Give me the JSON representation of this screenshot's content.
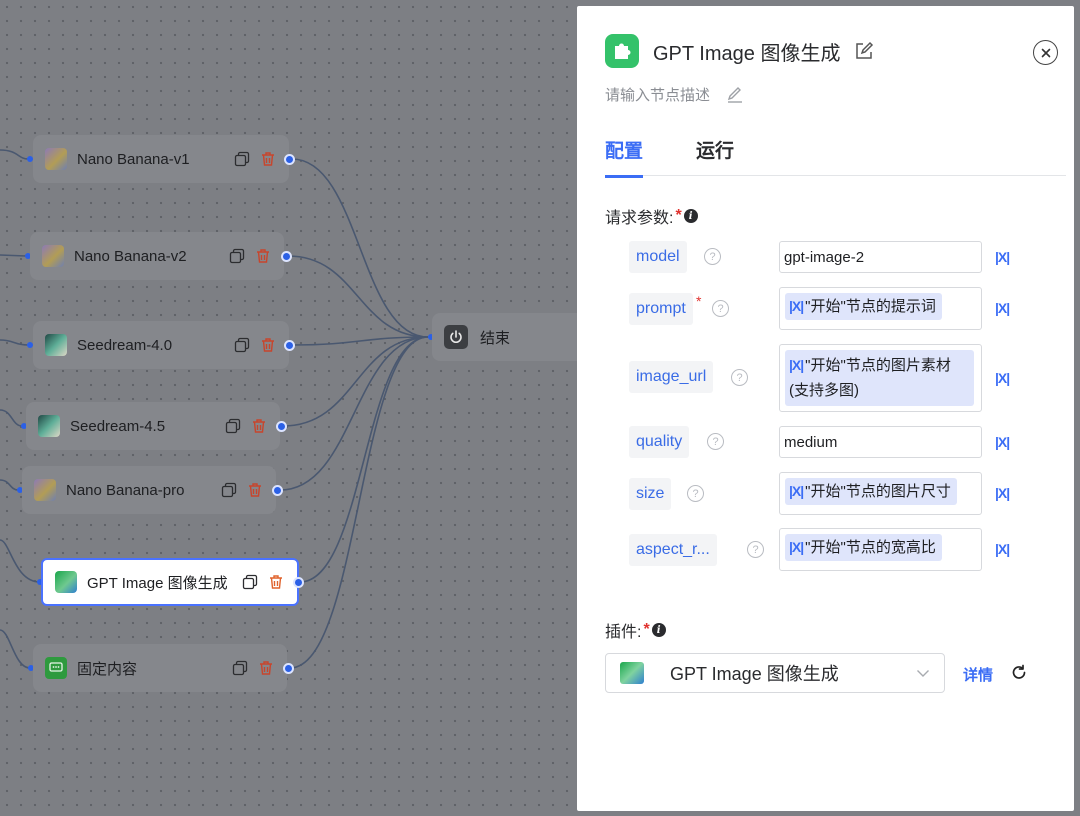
{
  "canvas": {
    "nodes": [
      {
        "label": "Nano Banana-v1",
        "thumb": "banana"
      },
      {
        "label": "Nano Banana-v2",
        "thumb": "banana"
      },
      {
        "label": "Seedream-4.0",
        "thumb": "seedream"
      },
      {
        "label": "Seedream-4.5",
        "thumb": "seedream"
      },
      {
        "label": "Nano Banana-pro",
        "thumb": "banana"
      },
      {
        "label": "GPT Image 图像生成",
        "thumb": "gpt"
      },
      {
        "label": "固定内容",
        "thumb": "fixed"
      }
    ],
    "end_node": {
      "label": "结束",
      "icon": "power-icon"
    }
  },
  "panel": {
    "title": "GPT Image 图像生成",
    "description_placeholder": "请输入节点描述",
    "tabs": [
      {
        "label": "配置",
        "active": true
      },
      {
        "label": "运行",
        "active": false
      }
    ],
    "params_label": "请求参数:",
    "required_mark": "*",
    "info_glyph": "i",
    "help_glyph": "?",
    "var_glyph": "|X|",
    "params": [
      {
        "name": "model",
        "required": false,
        "value_type": "text",
        "value": "gpt-image-2"
      },
      {
        "name": "prompt",
        "required": true,
        "value_type": "var",
        "value": "\"开始\"节点的提示词"
      },
      {
        "name": "image_url",
        "required": false,
        "value_type": "var",
        "value": "\"开始\"节点的图片素材(支持多图)"
      },
      {
        "name": "quality",
        "required": false,
        "value_type": "text",
        "value": "medium"
      },
      {
        "name": "size",
        "required": false,
        "value_type": "var",
        "value": "\"开始\"节点的图片尺寸"
      },
      {
        "name": "aspect_r...",
        "required": false,
        "value_type": "var",
        "value": "\"开始\"节点的宽高比"
      }
    ],
    "plugin_label": "插件:",
    "plugin_name": "GPT Image 图像生成",
    "detail_label": "详情"
  },
  "colors": {
    "accent": "#3b6df5",
    "required": "#e0322f",
    "plugin_logo": "#34c26a"
  }
}
